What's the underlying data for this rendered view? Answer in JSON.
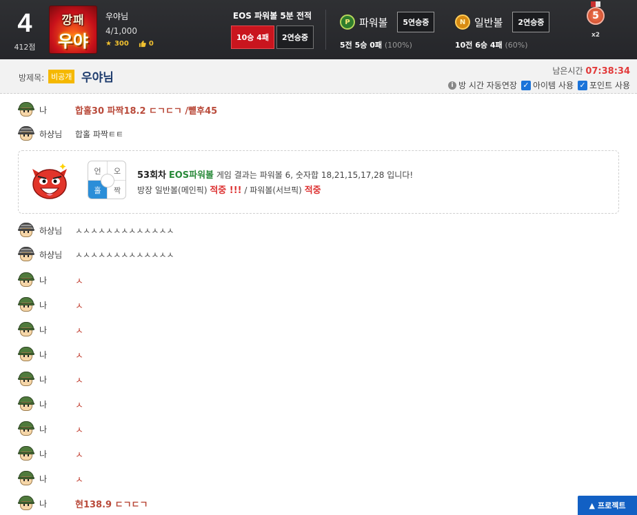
{
  "header": {
    "rank": "4",
    "score": "412점",
    "logo_line1": "깡패",
    "logo_line2": "우야",
    "user_name": "우야님",
    "user_level": "4/1,000",
    "stars": "300",
    "likes": "0",
    "record_title": "EOS 파워볼 5분 전적",
    "record_wl": "10승 4패",
    "record_streak": "2연승중",
    "powerball": {
      "coin": "P",
      "name": "파워볼",
      "streak": "5연승중",
      "summary": "5전 5승 0패",
      "pct": "(100%)"
    },
    "normalball": {
      "coin": "N",
      "name": "일반볼",
      "streak": "2연승중",
      "summary": "10전 6승 4패",
      "pct": "(60%)"
    },
    "medal_num": "5",
    "medal_mult": "x2"
  },
  "room": {
    "label": "방제목:",
    "private_badge": "비공개",
    "title": "우야님",
    "timer_label": "남은시간",
    "timer_value": "07:38:34",
    "auto_extend": "방 시간 자동연장",
    "item_use": "아이템 사용",
    "point_use": "포인트 사용"
  },
  "chat": [
    {
      "nick": "나",
      "helmet": "green",
      "text": "합홀30 파짝18.2 ㄷㄱㄷㄱ /뻍후45",
      "style": "red"
    },
    {
      "nick": "하샹님",
      "helmet": "gray",
      "text": "합홀 파짝ㅌㅌ",
      "style": "plain"
    },
    {
      "nick": "하샹님",
      "helmet": "gray",
      "text": "ㅅㅅㅅㅅㅅㅅㅅㅅㅅㅅㅅㅅㅅ",
      "style": "plain"
    },
    {
      "nick": "하샹님",
      "helmet": "gray",
      "text": "ㅅㅅㅅㅅㅅㅅㅅㅅㅅㅅㅅㅅㅅ",
      "style": "plain"
    },
    {
      "nick": "나",
      "helmet": "green",
      "text": "ㅅ",
      "style": "redsmall"
    },
    {
      "nick": "나",
      "helmet": "green",
      "text": "ㅅ",
      "style": "redsmall"
    },
    {
      "nick": "나",
      "helmet": "green",
      "text": "ㅅ",
      "style": "redsmall"
    },
    {
      "nick": "나",
      "helmet": "green",
      "text": "ㅅ",
      "style": "redsmall"
    },
    {
      "nick": "나",
      "helmet": "green",
      "text": "ㅅ",
      "style": "redsmall"
    },
    {
      "nick": "나",
      "helmet": "green",
      "text": "ㅅ",
      "style": "redsmall"
    },
    {
      "nick": "나",
      "helmet": "green",
      "text": "ㅅ",
      "style": "redsmall"
    },
    {
      "nick": "나",
      "helmet": "green",
      "text": "ㅅ",
      "style": "redsmall"
    },
    {
      "nick": "나",
      "helmet": "green",
      "text": "ㅅ",
      "style": "redsmall"
    },
    {
      "nick": "나",
      "helmet": "green",
      "text": "현138.9 ㄷㄱㄷㄱ",
      "style": "red"
    }
  ],
  "result": {
    "grid": [
      "언",
      "오",
      "홀",
      "짝"
    ],
    "round": "53회차",
    "game": "EOS파워볼",
    "line1_rest": "게임 결과는 파워볼 6, 숫자합 18,21,15,17,28 입니다!",
    "line2_a": "방장 일반볼(메인픽)",
    "line2_hit1": "적중 !!!",
    "line2_b": "/ 파워볼(서브픽)",
    "line2_hit2": "적중"
  },
  "project_button": "프로젝트",
  "colors": {
    "header_bg": "#2b2c30",
    "accent_red": "#c9151e",
    "link_blue": "#1260c4",
    "hit_red": "#d33333"
  }
}
